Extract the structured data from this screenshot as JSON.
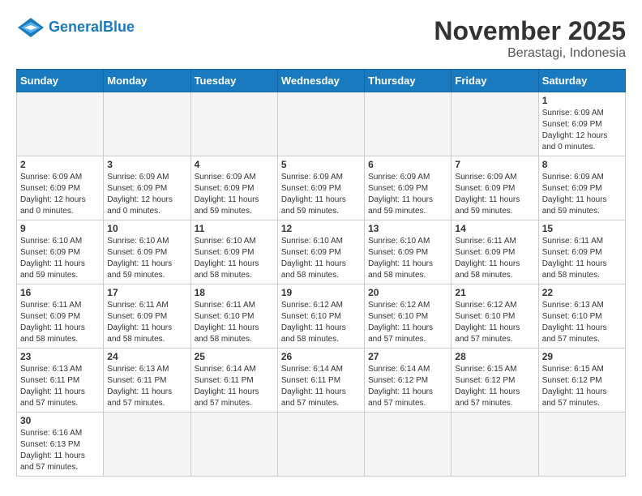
{
  "header": {
    "logo_general": "General",
    "logo_blue": "Blue",
    "title": "November 2025",
    "location": "Berastagi, Indonesia"
  },
  "weekdays": [
    "Sunday",
    "Monday",
    "Tuesday",
    "Wednesday",
    "Thursday",
    "Friday",
    "Saturday"
  ],
  "weeks": [
    [
      {
        "day": "",
        "info": ""
      },
      {
        "day": "",
        "info": ""
      },
      {
        "day": "",
        "info": ""
      },
      {
        "day": "",
        "info": ""
      },
      {
        "day": "",
        "info": ""
      },
      {
        "day": "",
        "info": ""
      },
      {
        "day": "1",
        "info": "Sunrise: 6:09 AM\nSunset: 6:09 PM\nDaylight: 12 hours\nand 0 minutes."
      }
    ],
    [
      {
        "day": "2",
        "info": "Sunrise: 6:09 AM\nSunset: 6:09 PM\nDaylight: 12 hours\nand 0 minutes."
      },
      {
        "day": "3",
        "info": "Sunrise: 6:09 AM\nSunset: 6:09 PM\nDaylight: 12 hours\nand 0 minutes."
      },
      {
        "day": "4",
        "info": "Sunrise: 6:09 AM\nSunset: 6:09 PM\nDaylight: 11 hours\nand 59 minutes."
      },
      {
        "day": "5",
        "info": "Sunrise: 6:09 AM\nSunset: 6:09 PM\nDaylight: 11 hours\nand 59 minutes."
      },
      {
        "day": "6",
        "info": "Sunrise: 6:09 AM\nSunset: 6:09 PM\nDaylight: 11 hours\nand 59 minutes."
      },
      {
        "day": "7",
        "info": "Sunrise: 6:09 AM\nSunset: 6:09 PM\nDaylight: 11 hours\nand 59 minutes."
      },
      {
        "day": "8",
        "info": "Sunrise: 6:09 AM\nSunset: 6:09 PM\nDaylight: 11 hours\nand 59 minutes."
      }
    ],
    [
      {
        "day": "9",
        "info": "Sunrise: 6:10 AM\nSunset: 6:09 PM\nDaylight: 11 hours\nand 59 minutes."
      },
      {
        "day": "10",
        "info": "Sunrise: 6:10 AM\nSunset: 6:09 PM\nDaylight: 11 hours\nand 59 minutes."
      },
      {
        "day": "11",
        "info": "Sunrise: 6:10 AM\nSunset: 6:09 PM\nDaylight: 11 hours\nand 58 minutes."
      },
      {
        "day": "12",
        "info": "Sunrise: 6:10 AM\nSunset: 6:09 PM\nDaylight: 11 hours\nand 58 minutes."
      },
      {
        "day": "13",
        "info": "Sunrise: 6:10 AM\nSunset: 6:09 PM\nDaylight: 11 hours\nand 58 minutes."
      },
      {
        "day": "14",
        "info": "Sunrise: 6:11 AM\nSunset: 6:09 PM\nDaylight: 11 hours\nand 58 minutes."
      },
      {
        "day": "15",
        "info": "Sunrise: 6:11 AM\nSunset: 6:09 PM\nDaylight: 11 hours\nand 58 minutes."
      }
    ],
    [
      {
        "day": "16",
        "info": "Sunrise: 6:11 AM\nSunset: 6:09 PM\nDaylight: 11 hours\nand 58 minutes."
      },
      {
        "day": "17",
        "info": "Sunrise: 6:11 AM\nSunset: 6:09 PM\nDaylight: 11 hours\nand 58 minutes."
      },
      {
        "day": "18",
        "info": "Sunrise: 6:11 AM\nSunset: 6:10 PM\nDaylight: 11 hours\nand 58 minutes."
      },
      {
        "day": "19",
        "info": "Sunrise: 6:12 AM\nSunset: 6:10 PM\nDaylight: 11 hours\nand 58 minutes."
      },
      {
        "day": "20",
        "info": "Sunrise: 6:12 AM\nSunset: 6:10 PM\nDaylight: 11 hours\nand 57 minutes."
      },
      {
        "day": "21",
        "info": "Sunrise: 6:12 AM\nSunset: 6:10 PM\nDaylight: 11 hours\nand 57 minutes."
      },
      {
        "day": "22",
        "info": "Sunrise: 6:13 AM\nSunset: 6:10 PM\nDaylight: 11 hours\nand 57 minutes."
      }
    ],
    [
      {
        "day": "23",
        "info": "Sunrise: 6:13 AM\nSunset: 6:11 PM\nDaylight: 11 hours\nand 57 minutes."
      },
      {
        "day": "24",
        "info": "Sunrise: 6:13 AM\nSunset: 6:11 PM\nDaylight: 11 hours\nand 57 minutes."
      },
      {
        "day": "25",
        "info": "Sunrise: 6:14 AM\nSunset: 6:11 PM\nDaylight: 11 hours\nand 57 minutes."
      },
      {
        "day": "26",
        "info": "Sunrise: 6:14 AM\nSunset: 6:11 PM\nDaylight: 11 hours\nand 57 minutes."
      },
      {
        "day": "27",
        "info": "Sunrise: 6:14 AM\nSunset: 6:12 PM\nDaylight: 11 hours\nand 57 minutes."
      },
      {
        "day": "28",
        "info": "Sunrise: 6:15 AM\nSunset: 6:12 PM\nDaylight: 11 hours\nand 57 minutes."
      },
      {
        "day": "29",
        "info": "Sunrise: 6:15 AM\nSunset: 6:12 PM\nDaylight: 11 hours\nand 57 minutes."
      }
    ],
    [
      {
        "day": "30",
        "info": "Sunrise: 6:16 AM\nSunset: 6:13 PM\nDaylight: 11 hours\nand 57 minutes."
      },
      {
        "day": "",
        "info": ""
      },
      {
        "day": "",
        "info": ""
      },
      {
        "day": "",
        "info": ""
      },
      {
        "day": "",
        "info": ""
      },
      {
        "day": "",
        "info": ""
      },
      {
        "day": "",
        "info": ""
      }
    ]
  ]
}
